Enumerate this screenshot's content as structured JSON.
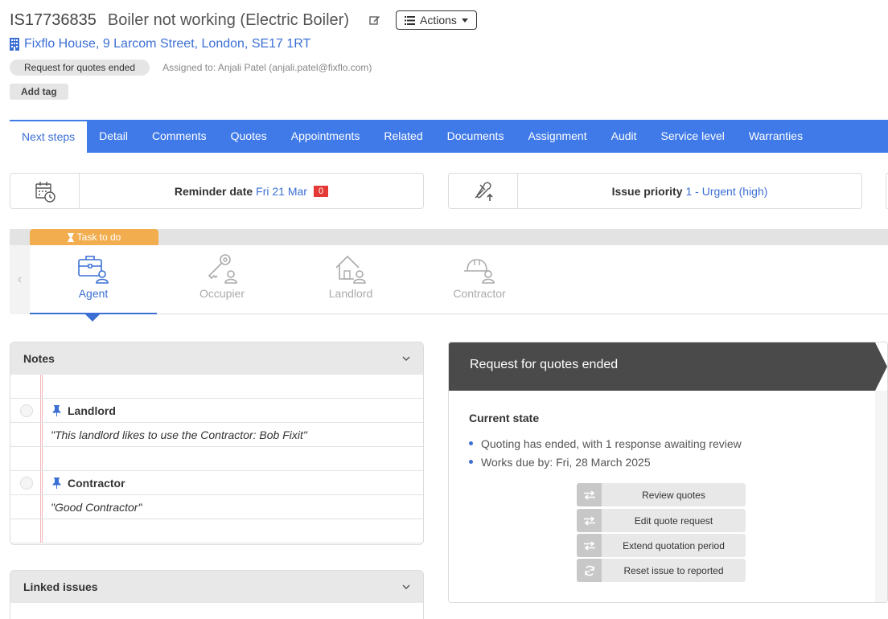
{
  "issue": {
    "id": "IS17736835",
    "title": "Boiler not working (Electric Boiler)",
    "actions_label": "Actions",
    "address": "Fixflo House, 9 Larcom Street, London, SE17 1RT",
    "status": "Request for quotes ended",
    "assigned": "Assigned to: Anjali Patel (anjali.patel@fixflo.com)",
    "add_tag": "Add tag"
  },
  "tabs": [
    {
      "label": "Next steps"
    },
    {
      "label": "Detail"
    },
    {
      "label": "Comments"
    },
    {
      "label": "Quotes"
    },
    {
      "label": "Appointments"
    },
    {
      "label": "Related"
    },
    {
      "label": "Documents"
    },
    {
      "label": "Assignment"
    },
    {
      "label": "Audit"
    },
    {
      "label": "Service level"
    },
    {
      "label": "Warranties"
    }
  ],
  "reminder": {
    "label": "Reminder date",
    "value": "Fri 21 Mar",
    "badge": "0"
  },
  "priority": {
    "label": "Issue priority",
    "value": "1 - Urgent (high)"
  },
  "workflow": {
    "task_label": "Task to do",
    "roles": [
      {
        "label": "Agent"
      },
      {
        "label": "Occupier"
      },
      {
        "label": "Landlord"
      },
      {
        "label": "Contractor"
      }
    ]
  },
  "notes": {
    "title": "Notes",
    "items": [
      {
        "heading": "Landlord",
        "text": "\"This landlord likes to use the Contractor: Bob Fixit\""
      },
      {
        "heading": "Contractor",
        "text": "\"Good Contractor\""
      }
    ]
  },
  "linked": {
    "title": "Linked issues"
  },
  "state": {
    "title": "Request for quotes ended",
    "subtitle": "Current state",
    "bullets": [
      "Quoting has ended, with 1 response awaiting review",
      "Works due by: Fri, 28 March 2025"
    ],
    "actions": [
      {
        "label": "Review quotes"
      },
      {
        "label": "Edit quote request"
      },
      {
        "label": "Extend quotation period"
      },
      {
        "label": "Reset issue to reported"
      }
    ]
  },
  "colors": {
    "brand": "#3f7ae8",
    "task": "#f2ad4e",
    "badge": "#e53935",
    "state_header": "#4a4a4a"
  }
}
